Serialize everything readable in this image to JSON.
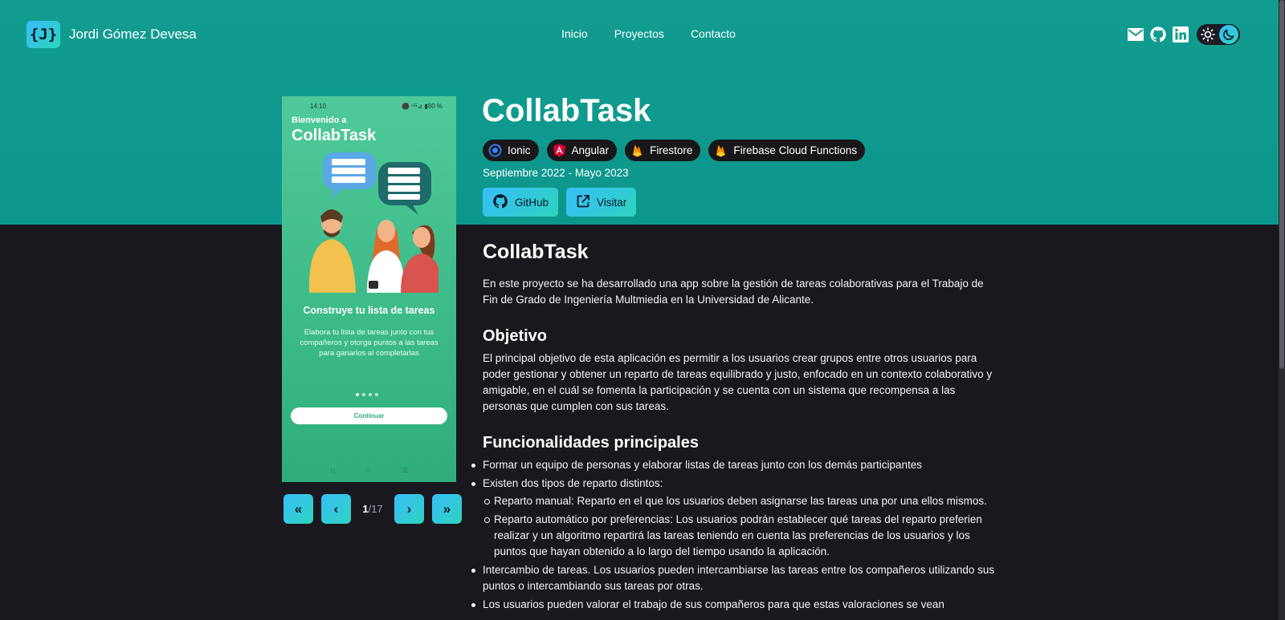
{
  "colors": {
    "hero_bg": "#129c90",
    "page_bg": "#19181e",
    "accent_gradient_start": "#38bdf8",
    "accent_gradient_end": "#2dd4bf",
    "tag_bg": "#18181b"
  },
  "navbar": {
    "logo_text": "{J}",
    "brand_name": "Jordi Gómez Devesa",
    "links": [
      "Inicio",
      "Proyectos",
      "Contacto"
    ],
    "social_icons": [
      "mail-icon",
      "github-icon",
      "linkedin-icon"
    ],
    "theme_toggle": {
      "light_icon": "sun-icon",
      "dark_icon": "moon-icon",
      "active": "dark"
    }
  },
  "screenshot": {
    "status_time": "14:10",
    "status_right": "⚫ ⁵ᴳ⊿ ▮80 %",
    "welcome": "Bienvenido a",
    "app_name": "CollabTask",
    "headline": "Construye tu lista de tareas",
    "body": "Elabora tu lista de tareas junto con tus compañeros y otorga puntos a las tareas para ganarlos al completarlas",
    "cta": "Continuar",
    "nav_glyphs": [
      "◁",
      "○",
      "☰"
    ]
  },
  "carousel": {
    "first_icon": "chevrons-left-icon",
    "prev_icon": "chevron-left-icon",
    "next_icon": "chevron-right-icon",
    "last_icon": "chevrons-right-icon",
    "current": "1",
    "total": "/17"
  },
  "project": {
    "title": "CollabTask",
    "tags": [
      {
        "label": "Ionic",
        "icon": "ionic-icon"
      },
      {
        "label": "Angular",
        "icon": "angular-icon"
      },
      {
        "label": "Firestore",
        "icon": "firebase-icon"
      },
      {
        "label": "Firebase Cloud Functions",
        "icon": "firebase-icon"
      }
    ],
    "dates": "Septiembre 2022 - Mayo 2023",
    "links": [
      {
        "label": "GitHub",
        "icon": "github-icon"
      },
      {
        "label": "Visitar",
        "icon": "external-link-icon"
      }
    ]
  },
  "article": {
    "heading": "CollabTask",
    "intro": "En este proyecto se ha desarrollado una app sobre la gestión de tareas colaborativas para el Trabajo de Fin de Grado de Ingeniería Multmiedia en la Universidad de Alicante.",
    "objective_heading": "Objetivo",
    "objective_text": "El principal objetivo de esta aplicación es permitir a los usuarios crear grupos entre otros usuarios para poder gestionar y obtener un reparto de tareas equilibrado y justo, enfocado en un contexto colaborativo y amigable, en el cuál se fomenta la participación y se cuenta con un sistema que recompensa a las personas que cumplen con sus tareas.",
    "features_heading": "Funcionalidades principales",
    "features": [
      "Formar un equipo de personas y elaborar listas de tareas junto con los demás participantes",
      "Existen dos tipos de reparto distintos:",
      "Intercambio de tareas. Los usuarios pueden intercambiarse las tareas entre los compañeros utilizando sus puntos o intercambiando sus tareas por otras.",
      "Los usuarios pueden valorar el trabajo de sus compañeros para que estas valoraciones se vean"
    ],
    "sub_features": [
      "Reparto manual: Reparto en el que los usuarios deben asignarse las tareas una por una ellos mismos.",
      "Reparto automático por preferencias: Los usuarios podrán establecer qué tareas del reparto preferien realizar y un algoritmo repartirá las tareas teniendo en cuenta las preferencias de los usuarios y los puntos que hayan obtenido a lo largo del tiempo usando la aplicación."
    ]
  }
}
